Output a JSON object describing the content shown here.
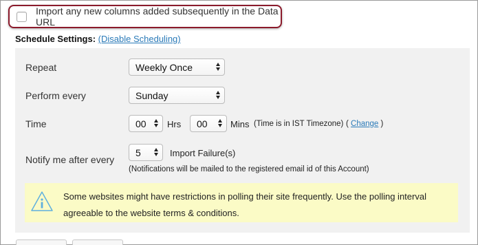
{
  "import_option": {
    "label": "Import any new columns added subsequently in the Data URL",
    "checked": false
  },
  "schedule": {
    "title": "Schedule Settings:",
    "disable_link": "(Disable Scheduling)"
  },
  "repeat": {
    "label": "Repeat",
    "value": "Weekly Once"
  },
  "perform": {
    "label": "Perform every",
    "value": "Sunday"
  },
  "time": {
    "label": "Time",
    "hours_value": "00",
    "hours_unit": "Hrs",
    "mins_value": "00",
    "mins_unit": "Mins",
    "timezone_note": "(Time is in IST Timezone)",
    "change_open": "(",
    "change_link": "Change",
    "change_close": ")"
  },
  "notify": {
    "label": "Notify me after every",
    "value": "5",
    "unit": "Import Failure(s)",
    "note": "(Notifications will be mailed to the registered email id of this Account)"
  },
  "warning": {
    "icon": "info-icon",
    "text": "Some websites might have restrictions in polling their site frequently. Use the polling interval agreeable to the website terms & conditions."
  },
  "colors": {
    "accent_link": "#2a7ab8",
    "highlight_border": "#8b1a2b",
    "note_bg": "#fbfbc6",
    "panel_bg": "#f1f1f1"
  }
}
